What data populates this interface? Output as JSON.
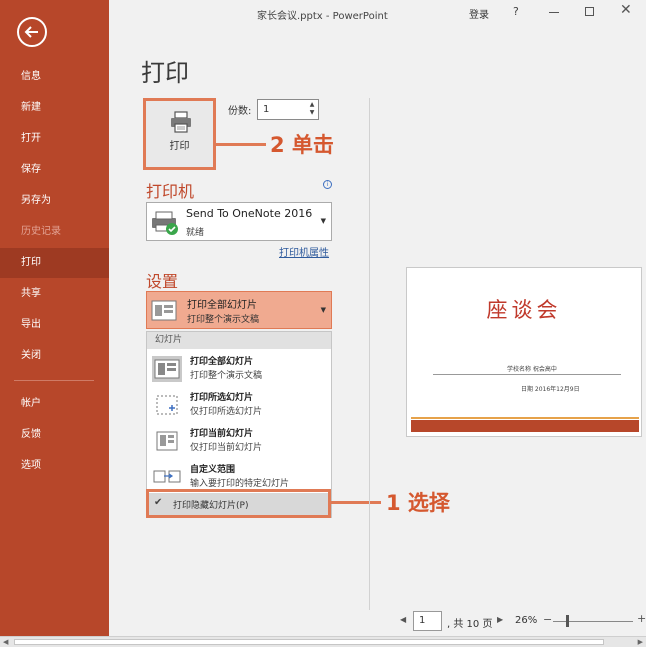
{
  "window": {
    "title": "家长会议.pptx  -  PowerPoint",
    "signin": "登录",
    "help": "?"
  },
  "sidebar": {
    "items": [
      {
        "label": "信息"
      },
      {
        "label": "新建"
      },
      {
        "label": "打开"
      },
      {
        "label": "保存"
      },
      {
        "label": "另存为"
      },
      {
        "label": "历史记录"
      },
      {
        "label": "打印"
      },
      {
        "label": "共享"
      },
      {
        "label": "导出"
      },
      {
        "label": "关闭"
      },
      {
        "label": "帐户"
      },
      {
        "label": "反馈"
      },
      {
        "label": "选项"
      }
    ]
  },
  "print": {
    "page_title": "打印",
    "button_label": "打印",
    "copies_label": "份数:",
    "copies_value": "1"
  },
  "printer": {
    "heading": "打印机",
    "name": "Send To OneNote 2016",
    "status": "就绪",
    "properties_link": "打印机属性"
  },
  "settings": {
    "heading": "设置",
    "selected_main": "打印全部幻灯片",
    "selected_sub": "打印整个演示文稿",
    "menu_header": "幻灯片",
    "options": [
      {
        "title": "打印全部幻灯片",
        "desc": "打印整个演示文稿"
      },
      {
        "title": "打印所选幻灯片",
        "desc": "仅打印所选幻灯片"
      },
      {
        "title": "打印当前幻灯片",
        "desc": "仅打印当前幻灯片"
      },
      {
        "title": "自定义范围",
        "desc": "输入要打印的特定幻灯片"
      }
    ],
    "hidden_check": "✔",
    "hidden_label": "打印隐藏幻灯片(P)"
  },
  "annotations": {
    "step1": "1 选择",
    "step2": "2 单击"
  },
  "slide": {
    "title": "座谈会",
    "sub1": "学校名称  祝会高中",
    "sub2": "日期  2016年12月9日"
  },
  "pager": {
    "page_value": "1",
    "total": ", 共 10 页",
    "zoom": "26%",
    "prev": "◀",
    "next": "▶",
    "minus": "−",
    "plus": "+"
  },
  "colors": {
    "sidebar": "#b7472a",
    "accent": "#e07a55",
    "heading": "#c0492c"
  }
}
